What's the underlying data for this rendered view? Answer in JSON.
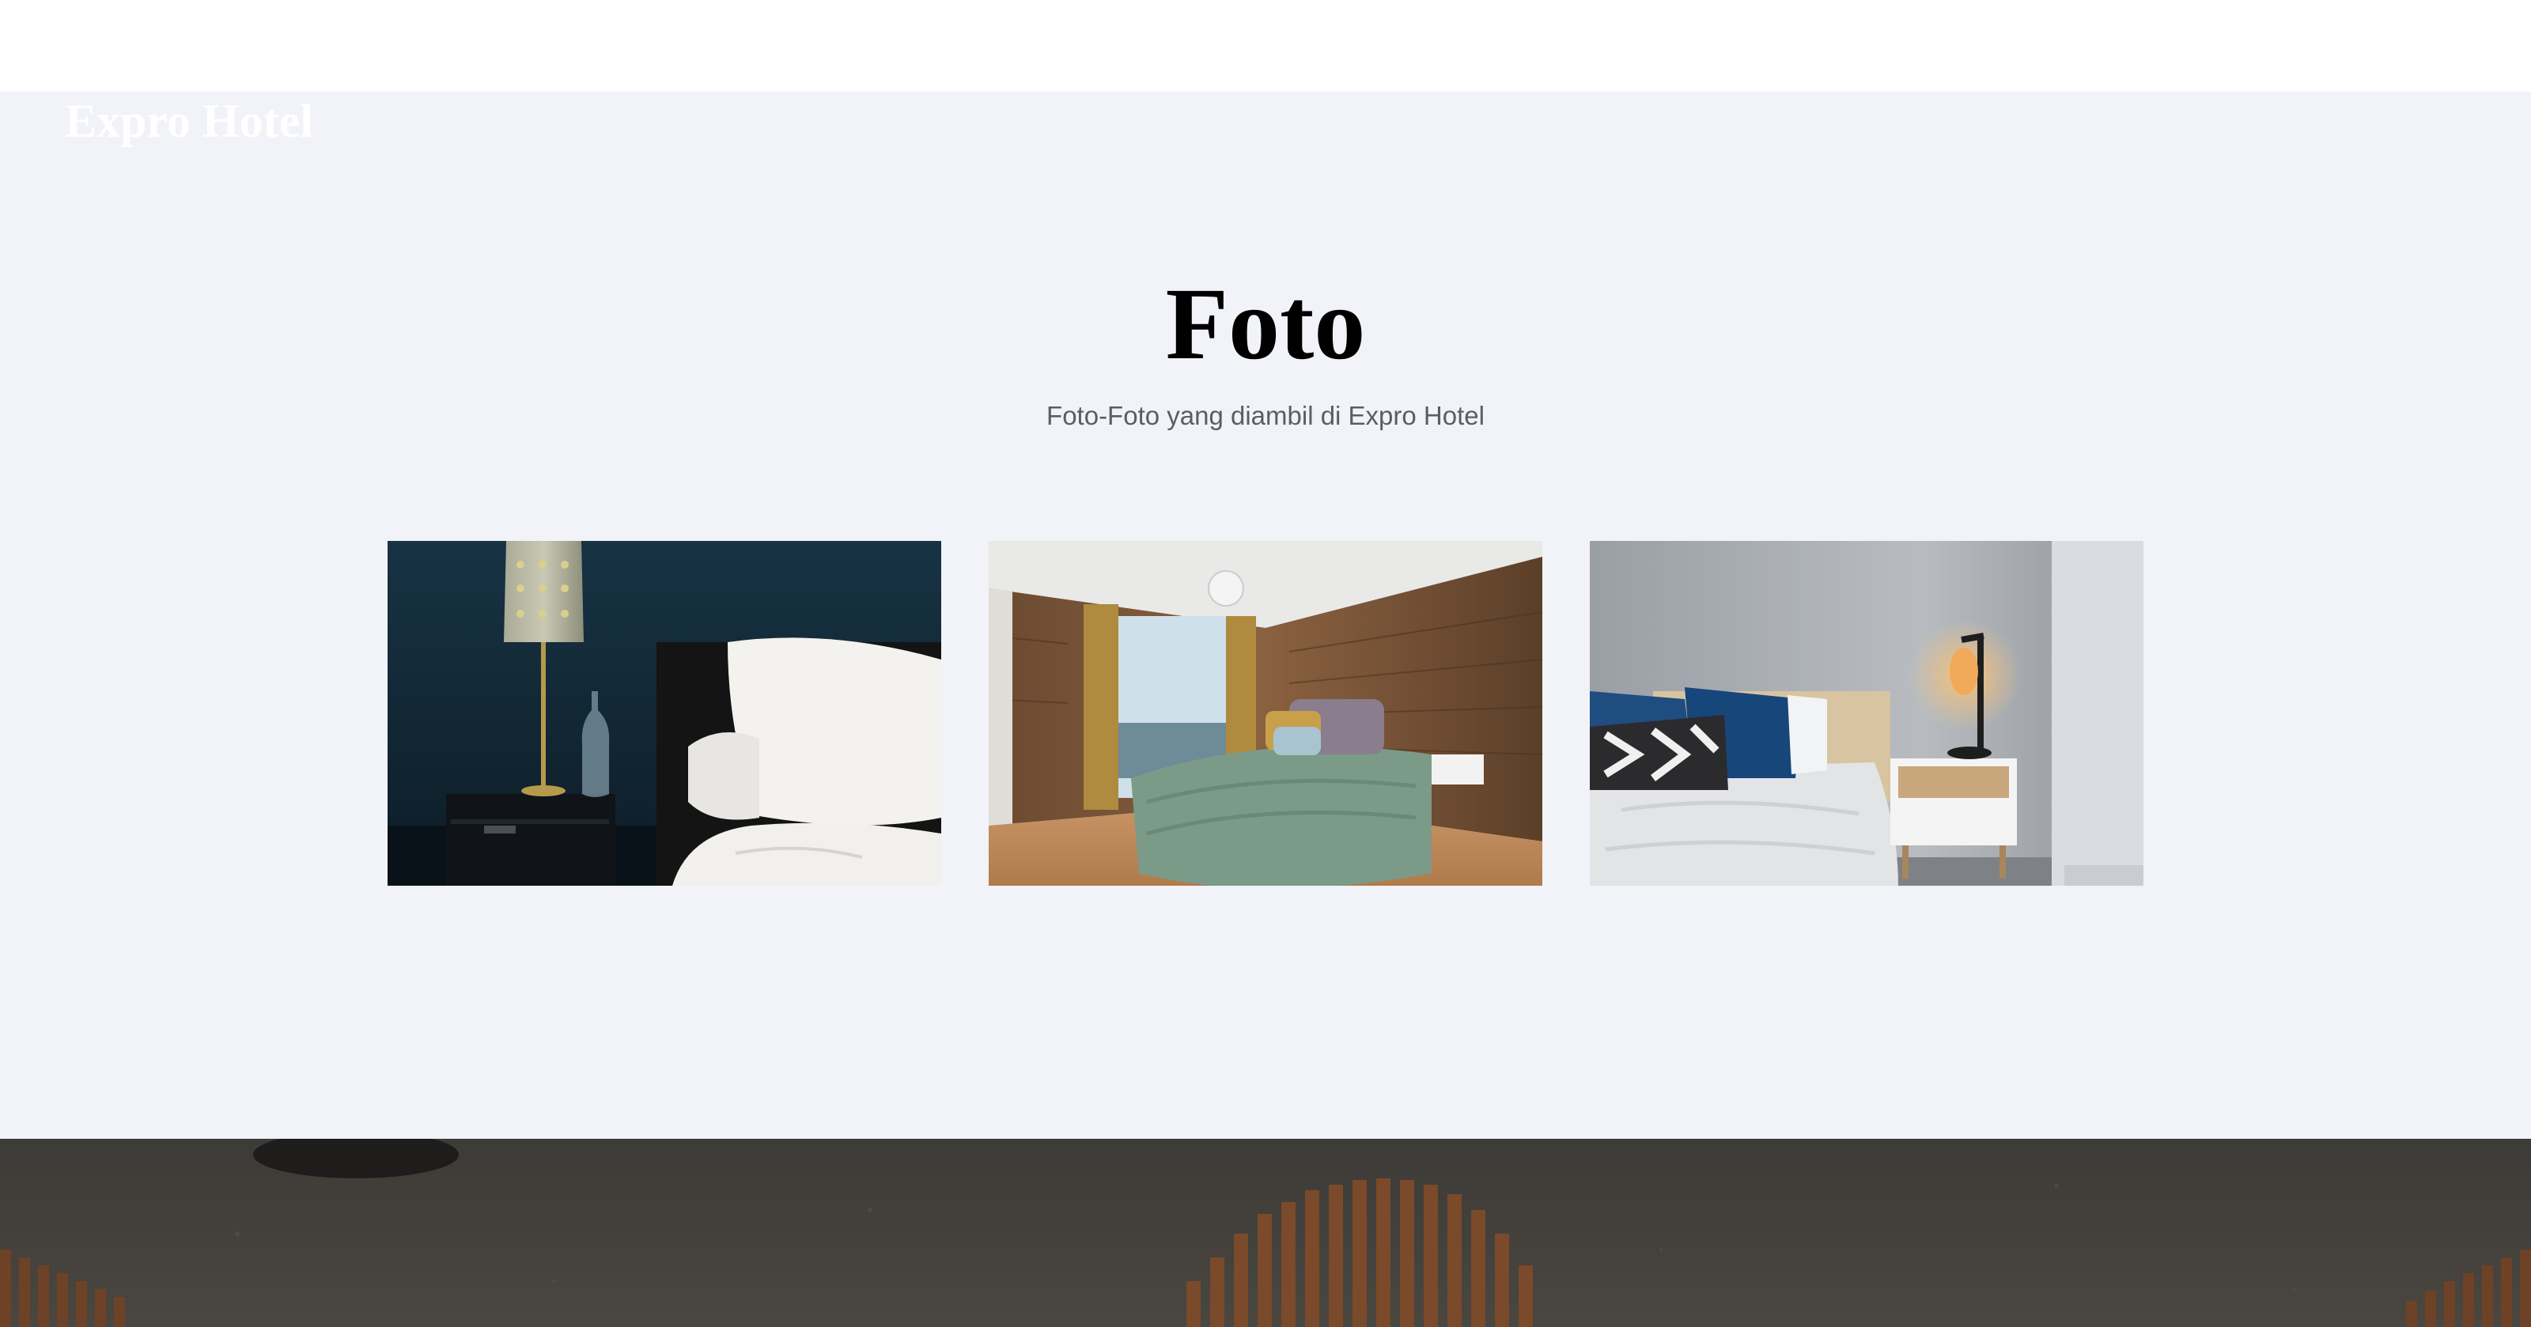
{
  "navbar": {
    "brand": "Expro Hotel"
  },
  "gallery": {
    "title": "Foto",
    "subtitle": "Foto-Foto yang diambil di Expro Hotel",
    "photos": [
      {
        "subject": "dark-blue-bedroom-with-lamp-photo"
      },
      {
        "subject": "wood-panel-bedroom-with-green-bedspread-photo"
      },
      {
        "subject": "white-bedroom-with-blue-pillows-and-nightstand-lamp-photo"
      }
    ]
  },
  "colors": {
    "section_background": "#f2f3f9",
    "title": "#000000",
    "subtitle": "#5a5c66",
    "brand": "#ffffff"
  }
}
